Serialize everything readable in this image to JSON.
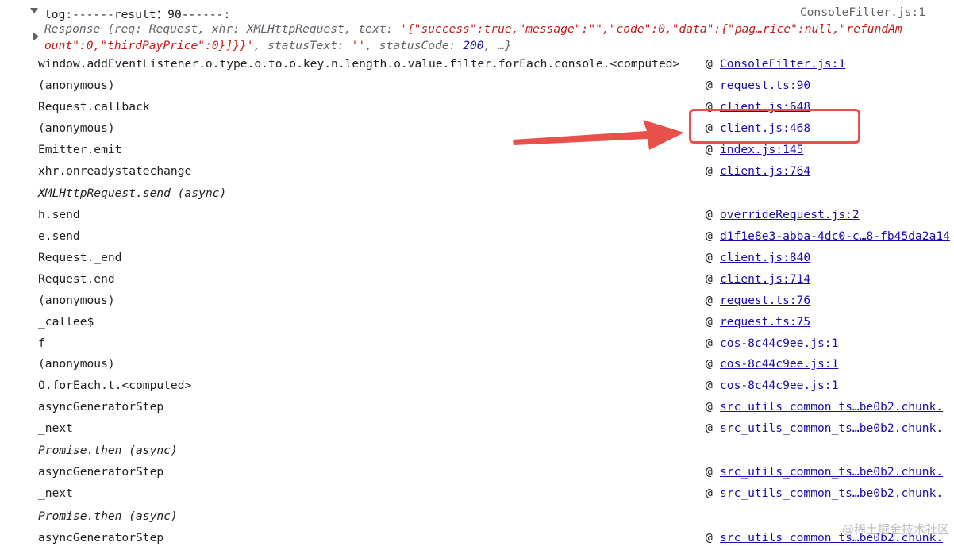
{
  "console": {
    "log_text": "log:------result：90------:",
    "log_source": "ConsoleFilter.js:1",
    "response": {
      "line1_prefix": "Response {req: Request, xhr: XMLHttpRequest, text: ",
      "line1_string": "'{\"success\":true,\"message\":\"\",\"code\":0,\"data\":{\"pag…rice\":null,\"refundAm",
      "line2_string": "ount\":0,\"thirdPayPrice\":0}]}}'",
      "line2_mid": ", statusText: ",
      "line2_status_text": "''",
      "line2_code_label": ", statusCode: ",
      "line2_code": "200",
      "line2_end": ", …}"
    },
    "at_symbol": "@",
    "stack": [
      {
        "fn": "window.addEventListener.o.type.o.to.o.key.n.length.o.value.filter.forEach.console.<computed>",
        "src": "ConsoleFilter.js:1",
        "async": false
      },
      {
        "fn": "(anonymous)",
        "src": "request.ts:90",
        "async": false
      },
      {
        "fn": "Request.callback",
        "src": "client.js:648",
        "async": false
      },
      {
        "fn": "(anonymous)",
        "src": "client.js:468",
        "async": false
      },
      {
        "fn": "Emitter.emit",
        "src": "index.js:145",
        "async": false
      },
      {
        "fn": "xhr.onreadystatechange",
        "src": "client.js:764",
        "async": false
      },
      {
        "fn": "XMLHttpRequest.send (async)",
        "src": "",
        "async": true
      },
      {
        "fn": "h.send",
        "src": "overrideRequest.js:2",
        "async": false
      },
      {
        "fn": "e.send",
        "src": "d1f1e8e3-abba-4dc0-c…8-fb45da2a14",
        "async": false
      },
      {
        "fn": "Request._end",
        "src": "client.js:840",
        "async": false
      },
      {
        "fn": "Request.end",
        "src": "client.js:714",
        "async": false
      },
      {
        "fn": "(anonymous)",
        "src": "request.ts:76",
        "async": false
      },
      {
        "fn": "_callee$",
        "src": "request.ts:75",
        "async": false
      },
      {
        "fn": "f",
        "src": "cos-8c44c9ee.js:1",
        "async": false
      },
      {
        "fn": "(anonymous)",
        "src": "cos-8c44c9ee.js:1",
        "async": false
      },
      {
        "fn": "O.forEach.t.<computed>",
        "src": "cos-8c44c9ee.js:1",
        "async": false
      },
      {
        "fn": "asyncGeneratorStep",
        "src": "src_utils_common_ts…be0b2.chunk.",
        "async": false
      },
      {
        "fn": "_next",
        "src": "src_utils_common_ts…be0b2.chunk.",
        "async": false
      },
      {
        "fn": "Promise.then (async)",
        "src": "",
        "async": true
      },
      {
        "fn": "asyncGeneratorStep",
        "src": "src_utils_common_ts…be0b2.chunk.",
        "async": false
      },
      {
        "fn": "_next",
        "src": "src_utils_common_ts…be0b2.chunk.",
        "async": false
      },
      {
        "fn": "Promise.then (async)",
        "src": "",
        "async": true
      },
      {
        "fn": "asyncGeneratorStep",
        "src": "src_utils_common_ts…be0b2.chunk.",
        "async": false
      }
    ]
  },
  "annotation": {
    "highlight_color": "#e8504a"
  },
  "watermark": "@稀土掘金技术社区"
}
